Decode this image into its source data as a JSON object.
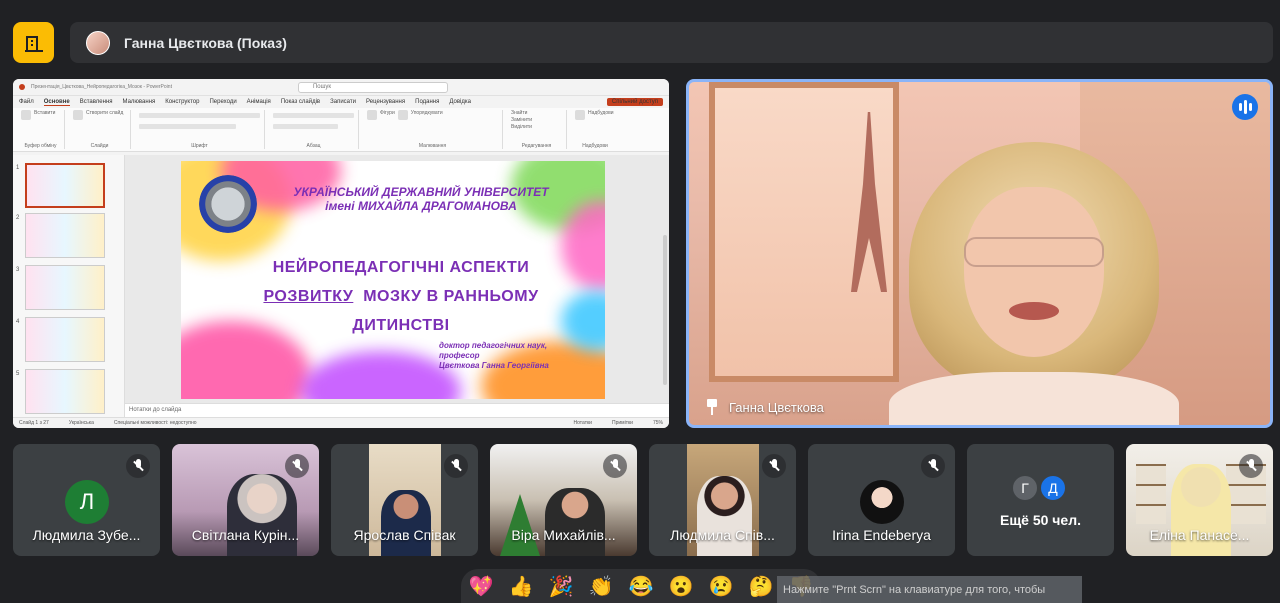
{
  "header": {
    "presenter_label": "Ганна Цвєткова (Показ)"
  },
  "shared_screen": {
    "app_title": "Презентація_Цвєткова_Нейропедагогіка_Мозок - PowerPoint",
    "search_placeholder": "Пошук",
    "menu_tabs": [
      "Файл",
      "Основне",
      "Вставлення",
      "Малювання",
      "Конструктор",
      "Переходи",
      "Анімація",
      "Показ слайдів",
      "Записати",
      "Рецензування",
      "Подання",
      "Довідка"
    ],
    "share_button": "Спільний доступ",
    "ribbon_groups": [
      "Буфер обміну",
      "Слайди",
      "Шрифт",
      "Абзац",
      "Малювання",
      "Редагування",
      "Надбудови"
    ],
    "ribbon_labels": {
      "paste": "Вставити",
      "new_slide": "Створити слайд",
      "shapes": "Фігури",
      "arrange": "Упорядкувати",
      "find": "Знайти",
      "replace": "Замінити",
      "select": "Виділити",
      "addins": "Надбудови"
    },
    "thumb_numbers": [
      "1",
      "2",
      "3",
      "4",
      "5"
    ],
    "slide": {
      "university": "УКРАЇНСЬКИЙ ДЕРЖАВНИЙ УНІВЕРСИТЕТ",
      "university_name": "імені МИХАЙЛА ДРАГОМАНОВА",
      "title_line1": "НЕЙРОПЕДАГОГІЧНІ АСПЕКТИ",
      "title_line2_u": "РОЗВИТКУ",
      "title_line2_rest": "МОЗКУ В РАННЬОМУ",
      "title_line3": "ДИТИНСТВІ",
      "author_line1": "доктор педагогічних наук,",
      "author_line2": "професор",
      "author_line3": "Цвєткова Ганна Георгіївна"
    },
    "notes_placeholder": "Нотатки до слайда",
    "status": {
      "slide_counter": "Слайд 1 з 27",
      "language": "Українська",
      "accessibility": "Спеціальні можливості: недоступно",
      "notes_btn": "Нотатки",
      "comments_btn": "Примітки",
      "zoom": "75%"
    }
  },
  "main_video": {
    "name": "Ганна Цвєткова"
  },
  "participants": [
    {
      "name": "Людмила Зубе...",
      "avatar_letter": "Л"
    },
    {
      "name": "Світлана Курін..."
    },
    {
      "name": "Ярослав Співак"
    },
    {
      "name": "Віра Михайлів..."
    },
    {
      "name": "Людмила Спів..."
    },
    {
      "name": "Irina Endeberya"
    },
    {
      "name": "Еліна Панасе..."
    }
  ],
  "more_tile": {
    "letters": [
      "Г",
      "Д"
    ],
    "label": "Ещё 50 чел."
  },
  "reactions": [
    "💖",
    "👍",
    "🎉",
    "👏",
    "😂",
    "😮",
    "😢",
    "🤔",
    "👎"
  ],
  "hint": "Нажмите \"Prnt Scrn\" на клавиатуре для того, чтобы",
  "colors": {
    "logo": "#fbbc04",
    "active_speaker_border": "#8ab4f8",
    "slide_text": "#7b2fb5",
    "ppt_accent": "#c43e1c"
  }
}
